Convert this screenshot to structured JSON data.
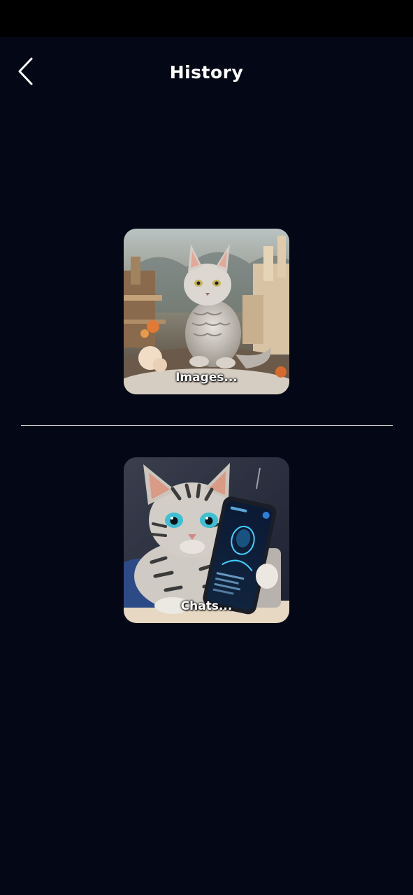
{
  "header": {
    "title": "History",
    "back_icon": "chevron-left-icon"
  },
  "cards": {
    "images": {
      "label": "Images..."
    },
    "chats": {
      "label": "Chats..."
    }
  },
  "colors": {
    "background": "#040716",
    "status_bar": "#000000",
    "text": "#ffffff",
    "divider": "#c9ccd6"
  }
}
